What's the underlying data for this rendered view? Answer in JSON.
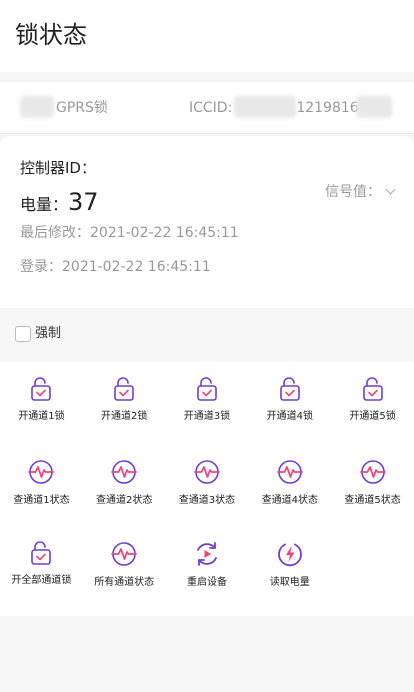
{
  "page_title": "锁状态",
  "device": {
    "name": "GPRS锁",
    "iccid_prefix": "ICCID:",
    "iccid_visible": "12198165"
  },
  "info": {
    "controller_label": "控制器ID：",
    "power_label": "电量：",
    "power_value": "37",
    "signal_label": "信号值：",
    "last_modified": "最后修改：2021-02-22 16:45:11",
    "login": "登录：2021-02-22 16:45:11"
  },
  "force": {
    "label": "强制",
    "checked": false
  },
  "actions": [
    {
      "label": "开通道1锁",
      "icon": "unlock-icon"
    },
    {
      "label": "开通道2锁",
      "icon": "unlock-icon"
    },
    {
      "label": "开通道3锁",
      "icon": "unlock-icon"
    },
    {
      "label": "开通道4锁",
      "icon": "unlock-icon"
    },
    {
      "label": "开通道5锁",
      "icon": "unlock-icon"
    },
    {
      "label": "查通道1状态",
      "icon": "pulse-icon"
    },
    {
      "label": "查通道2状态",
      "icon": "pulse-icon"
    },
    {
      "label": "查通道3状态",
      "icon": "pulse-icon"
    },
    {
      "label": "查通道4状态",
      "icon": "pulse-icon"
    },
    {
      "label": "查通道5状态",
      "icon": "pulse-icon"
    },
    {
      "label": "开全部通道锁",
      "icon": "unlock-icon"
    },
    {
      "label": "所有通道状态",
      "icon": "pulse-icon"
    },
    {
      "label": "重启设备",
      "icon": "restart-icon"
    },
    {
      "label": "读取电量",
      "icon": "battery-bolt-icon"
    }
  ],
  "colors": {
    "accent_purple": "#6e3cd6",
    "accent_pink": "#f0457a"
  }
}
